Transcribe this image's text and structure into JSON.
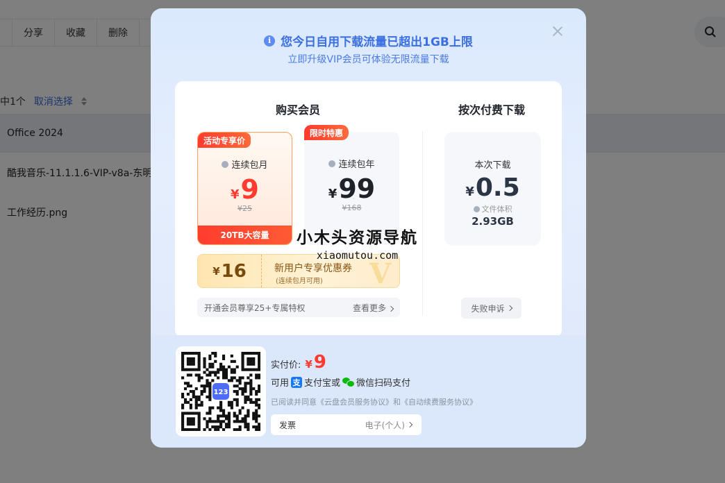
{
  "toolbar": {
    "share": "分享",
    "favorite": "收藏",
    "delete": "删除"
  },
  "selection": {
    "count_text": "中1个",
    "cancel": "取消选择"
  },
  "files": [
    {
      "name": "Office 2024"
    },
    {
      "name": "酷我音乐-11.1.1.6-VIP-v8a-东明."
    },
    {
      "name": "工作经历.png"
    }
  ],
  "modal": {
    "title": "您今日自用下载流量已超出1GB上限",
    "subtitle": "立即升级VIP会员可体验无限流量下载",
    "buy_section_title": "购买会员",
    "pay_once_section_title": "按次付费下载",
    "plans": [
      {
        "tag": "活动专享价",
        "name": "连续包月",
        "currency": "¥",
        "price": "9",
        "original": "¥25",
        "footer": "20TB大容量"
      },
      {
        "tag": "限时特惠",
        "name": "连续包年",
        "currency": "¥",
        "price": "99",
        "original": "¥168"
      }
    ],
    "coupon": {
      "currency": "¥",
      "amount": "16",
      "title": "新用户专享优惠券",
      "subtitle": "(连续包月可用)"
    },
    "perks": {
      "text": "开通会员尊享25+专属特权",
      "more": "查看更多"
    },
    "pay_once": {
      "name": "本次下载",
      "currency": "¥",
      "price": "0.5",
      "size_label": "文件体积",
      "size": "2.93GB",
      "appeal": "失败申诉"
    },
    "checkout": {
      "price_label": "实付价:",
      "currency": "¥",
      "price": "9",
      "pay_prefix": "可用",
      "alipay": "支付宝或",
      "wechat": "微信扫码支付",
      "agreement": "已阅读并同意《云盘会员服务协议》和《自动续费服务协议》",
      "invoice_label": "发票",
      "invoice_value": "电子(个人)",
      "qr_badge": "123"
    }
  },
  "watermark": {
    "line1": "小木头资源导航",
    "line2": "xiaomutou.com"
  },
  "colors": {
    "accent": "#3a6fe0",
    "price_red": "#ff3b2f",
    "alipay": "#1677ff",
    "wechat": "#09bb07"
  }
}
